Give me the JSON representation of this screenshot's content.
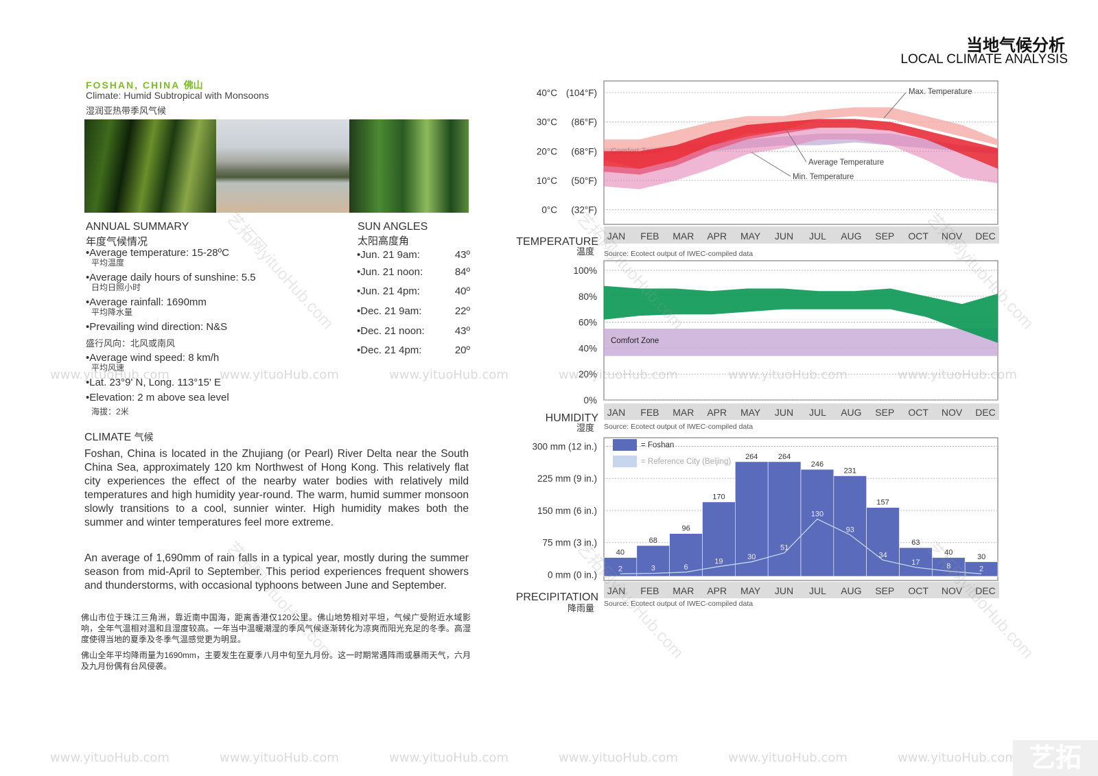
{
  "header": {
    "title_cn": "当地气候分析",
    "title_en": "LOCAL CLIMATE ANALYSIS"
  },
  "location": {
    "city": "FOSHAN, CHINA",
    "city_cn": "佛山",
    "climate": "Climate: Humid Subtropical with Monsoons",
    "climate_cn": "湿润亚热带季风气候"
  },
  "annual_summary": {
    "heading": "ANNUAL SUMMARY",
    "heading_cn": "年度气候情况",
    "items": [
      {
        "text": "•Average temperature: 15-28ºC",
        "cn": "平均温度"
      },
      {
        "text": "•Average daily hours of sunshine: 5.5",
        "cn": "日均日照小时"
      },
      {
        "text": "•Average rainfall: 1690mm",
        "cn": "平均降水量"
      },
      {
        "text": "•Prevailing wind direction:  N&S",
        "cn": "盛行风向：北风或南风"
      },
      {
        "text": "•Average wind speed: 8 km/h",
        "cn": "平均风速"
      },
      {
        "text": "•Lat. 23°9' N, Long. 113°15' E",
        "cn": ""
      },
      {
        "text": "•Elevation: 2 m above sea level",
        "cn": "海拔：2米"
      }
    ]
  },
  "sun_angles": {
    "heading": "SUN ANGLES",
    "heading_cn": "太阳高度角",
    "rows": [
      {
        "label": "•Jun. 21 9am:",
        "value": "43º"
      },
      {
        "label": "•Jun. 21 noon:",
        "value": "84º"
      },
      {
        "label": "•Jun. 21 4pm:",
        "value": "40º"
      },
      {
        "label": "•Dec. 21 9am:",
        "value": "22º"
      },
      {
        "label": "•Dec. 21 noon:",
        "value": "43º"
      },
      {
        "label": "•Dec. 21 4pm:",
        "value": "20º"
      }
    ]
  },
  "climate": {
    "heading": "CLIMATE",
    "heading_cn": "气候",
    "para1": "Foshan, China is located in the Zhujiang (or Pearl) River Delta near the South China Sea, approximately 120 km Northwest of Hong Kong.  This relatively flat city experiences the effect of the nearby water bodies with relatively mild temperatures and high humidity year-round.    The warm, humid summer monsoon slowly transitions to a cool, sunnier winter.  High humidity makes both the summer and winter temperatures feel more extreme.",
    "para2": "An average of 1,690mm of rain falls in a typical year, mostly during the summer season from mid-April to September.  This period experiences frequent showers and thunderstorms, with occasional typhoons between June and September.",
    "cn1": "佛山市位于珠江三角洲，靠近南中国海，距离香港仅120公里。佛山地势相对平坦，气候广受附近水域影响，全年气温相对温和且湿度较高。一年当中温暖潮湿的季风气候逐渐转化为凉爽而阳光充足的冬季。高湿度使得当地的夏季及冬季气温感觉更为明显。",
    "cn2": "佛山全年平均降雨量为1690mm，主要发生在夏季八月中旬至九月份。这一时期常遇阵雨或暴雨天气，六月及九月份偶有台风侵袭。"
  },
  "watermark": {
    "text": "www.yituoHub.com",
    "diag": "艺拓网yituoHub.com",
    "logo": "艺拓"
  },
  "colors": {
    "temp_max": "#f4a6a0",
    "temp_avg": "#e8222f",
    "temp_min": "#e487b8",
    "temp_comfort": "#a98fc8",
    "humidity": "#0e9a57",
    "humidity_comfort": "#c7a9d6",
    "precip_foshan": "#5a6bbb",
    "precip_beijing": "#c6d6ef",
    "month_band": "#dcdcdc"
  },
  "chart_data": [
    {
      "type": "area",
      "section_label": "TEMPERATURE",
      "section_label_cn": "温度",
      "source": "Source: Ecotect output of IWEC-compiled data",
      "categories": [
        "JAN",
        "FEB",
        "MAR",
        "APR",
        "MAY",
        "JUN",
        "JUL",
        "AUG",
        "SEP",
        "OCT",
        "NOV",
        "DEC"
      ],
      "y_ticks": [
        {
          "value": 0,
          "label": "0°C",
          "label2": "(32°F)"
        },
        {
          "value": 10,
          "label": "10°C",
          "label2": "(50°F)"
        },
        {
          "value": 20,
          "label": "20°C",
          "label2": "(68°F)"
        },
        {
          "value": 30,
          "label": "30°C",
          "label2": "(86°F)"
        },
        {
          "value": 40,
          "label": "40°C",
          "label2": "(104°F)"
        }
      ],
      "ylim": [
        -5,
        44
      ],
      "comfort_zone": {
        "label": "Comfort Zone",
        "low": [
          19,
          19,
          20,
          20,
          21,
          22,
          22,
          23,
          22,
          21,
          20,
          19
        ],
        "high": [
          21,
          21,
          22,
          23,
          24,
          25,
          26,
          26,
          26,
          24,
          22,
          21
        ]
      },
      "annotations": [
        "Max. Temperature",
        "Average Temperature",
        "Min. Temperature"
      ],
      "series": [
        {
          "name": "Max. Temperature",
          "low": [
            17,
            14,
            17,
            22,
            26,
            27,
            31,
            32,
            31,
            28,
            25,
            22
          ],
          "high": [
            24,
            24,
            27,
            30,
            32,
            32,
            34,
            35,
            35,
            32,
            29,
            24
          ]
        },
        {
          "name": "Average Temperature",
          "low": [
            13,
            12,
            15,
            20,
            24,
            26,
            28,
            28,
            27,
            24,
            19,
            14
          ],
          "high": [
            20,
            20,
            22,
            26,
            29,
            30,
            31,
            31,
            30,
            27,
            24,
            21
          ]
        },
        {
          "name": "Min. Temperature",
          "low": [
            8,
            7,
            10,
            14,
            19,
            21,
            24,
            24,
            22,
            17,
            11,
            9
          ],
          "high": [
            15,
            14,
            17,
            22,
            25,
            27,
            28,
            28,
            27,
            24,
            19,
            14
          ]
        }
      ]
    },
    {
      "type": "area",
      "section_label": "HUMIDITY",
      "section_label_cn": "湿度",
      "source": "Source: Ecotect output of IWEC-compiled data",
      "categories": [
        "JAN",
        "FEB",
        "MAR",
        "APR",
        "MAY",
        "JUN",
        "JUL",
        "AUG",
        "SEP",
        "OCT",
        "NOV",
        "DEC"
      ],
      "y_ticks": [
        {
          "value": 0,
          "label": "0%"
        },
        {
          "value": 20,
          "label": "20%"
        },
        {
          "value": 40,
          "label": "40%"
        },
        {
          "value": 60,
          "label": "60%"
        },
        {
          "value": 80,
          "label": "80%"
        },
        {
          "value": 100,
          "label": "100%"
        }
      ],
      "ylim": [
        0,
        100
      ],
      "comfort_zone": {
        "label": "Comfort Zone",
        "low": 34,
        "high": 55
      },
      "series": [
        {
          "name": "Humidity",
          "low": [
            62,
            65,
            66,
            66,
            68,
            70,
            70,
            70,
            70,
            64,
            54,
            44
          ],
          "high": [
            88,
            86,
            86,
            84,
            86,
            86,
            84,
            84,
            86,
            80,
            74,
            82
          ]
        }
      ]
    },
    {
      "type": "bar",
      "section_label": "PRECIPITATION",
      "section_label_cn": "降雨量",
      "source": "Source: Ecotect output of IWEC-compiled data",
      "categories": [
        "JAN",
        "FEB",
        "MAR",
        "APR",
        "MAY",
        "JUN",
        "JUL",
        "AUG",
        "SEP",
        "OCT",
        "NOV",
        "DEC"
      ],
      "y_ticks": [
        {
          "value": 0,
          "label": "0 mm (0 in.)"
        },
        {
          "value": 75,
          "label": "75 mm (3 in.)"
        },
        {
          "value": 150,
          "label": "150 mm (6 in.)"
        },
        {
          "value": 225,
          "label": "225 mm (9 in.)"
        },
        {
          "value": 300,
          "label": "300 mm (12 in.)"
        }
      ],
      "ylim": [
        -4,
        320
      ],
      "legend": [
        "= Foshan",
        "= Reference City (Beijing)"
      ],
      "series": [
        {
          "name": "Foshan",
          "values": [
            40,
            68,
            96,
            170,
            264,
            264,
            246,
            231,
            157,
            63,
            40,
            30
          ]
        },
        {
          "name": "Reference City (Beijing)",
          "values": [
            2,
            3,
            6,
            19,
            30,
            51,
            130,
            93,
            34,
            17,
            8,
            2
          ]
        }
      ]
    }
  ]
}
